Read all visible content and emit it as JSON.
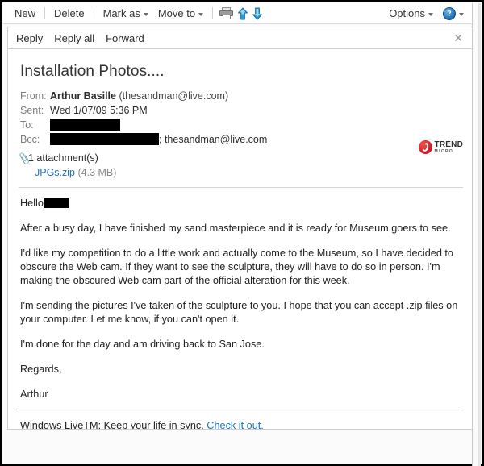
{
  "toolbar": {
    "new_label": "New",
    "delete_label": "Delete",
    "mark_as_label": "Mark as",
    "move_to_label": "Move to",
    "print_icon": "printer-icon",
    "move_up_icon": "arrow-up-icon",
    "move_down_icon": "arrow-down-icon",
    "options_label": "Options",
    "help_icon_glyph": "?"
  },
  "replybar": {
    "reply_label": "Reply",
    "reply_all_label": "Reply all",
    "forward_label": "Forward",
    "close_glyph": "✕"
  },
  "message": {
    "subject": "Installation Photos....",
    "fields": {
      "from_label": "From:",
      "from_name": "Arthur Basille",
      "from_email": "(thesandman@live.com)",
      "sent_label": "Sent:",
      "sent_value": "Wed 1/07/09 5:36 PM",
      "to_label": "To:",
      "to_value_redacted": true,
      "bcc_label": "Bcc:",
      "bcc_value_redacted": true,
      "bcc_trailing": "; thesandman@live.com"
    },
    "attachment": {
      "clip_icon": "paperclip-icon",
      "count_text": "1 attachment(s)",
      "file_name": "JPGs.zip",
      "file_size": "(4.3 MB)"
    },
    "branding": {
      "logo_icon": "trend-micro-logo-icon",
      "line1": "TREND",
      "line2": "MICRO"
    },
    "body": {
      "greeting": "Hello",
      "paragraph_1": "After a busy day, I have finished my sand masterpiece and it is ready for Museum goers to see.",
      "paragraph_2": "I'd like my competition to do a little work and actually come to the Museum, so I have decided to obscure the Web cam. If they want to see the sculpture, they will have to do so in person. I'm making the obscured Web cam part of the official alteration for this week.",
      "paragraph_3": "I'm sending the pictures I've taken of the sculpture to you. I hope that you can accept .zip files on your computer. Let me know, if you can't open it.",
      "paragraph_4": "I'm done for the day and am driving back to San Jose.",
      "closing": "Regards,",
      "signature_name": "Arthur"
    },
    "footer": {
      "text": "Windows LiveTM: Keep your life in sync.",
      "link_text": "Check it out."
    }
  },
  "colors": {
    "link": "#1f6fc4",
    "brand_red": "#d8202a",
    "accent_blue": "#2a7ec4",
    "redaction": "#000000"
  }
}
